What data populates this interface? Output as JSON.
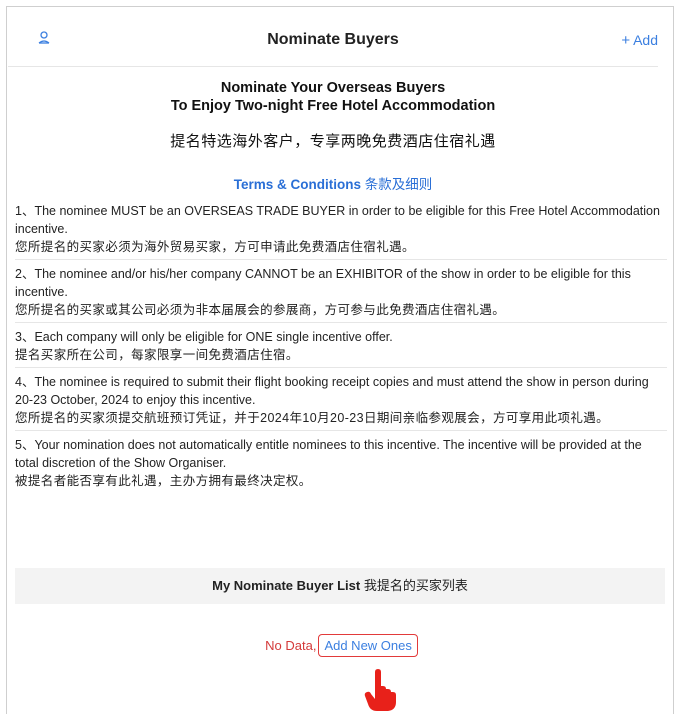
{
  "header": {
    "title": "Nominate Buyers",
    "add_plus": "+",
    "add_label": "Add"
  },
  "intro": {
    "line1": "Nominate Your Overseas Buyers",
    "line2": "To Enjoy Two-night Free Hotel Accommodation",
    "cn": "提名特选海外客户，专享两晚免费酒店住宿礼遇"
  },
  "terms_title": {
    "en": "Terms & Conditions",
    "cn": "条款及细则"
  },
  "terms": [
    {
      "en": "1、The nominee MUST be an OVERSEAS TRADE BUYER in order to be eligible for this Free Hotel Accommodation incentive.",
      "cn": "您所提名的买家必须为海外贸易买家，方可申请此免费酒店住宿礼遇。"
    },
    {
      "en": "2、The nominee and/or his/her company CANNOT be an EXHIBITOR of the show in order to be eligible for this incentive.",
      "cn": "您所提名的买家或其公司必须为非本届展会的参展商，方可参与此免费酒店住宿礼遇。"
    },
    {
      "en": "3、Each company will only be eligible for ONE single incentive offer.",
      "cn": "提名买家所在公司，每家限享一间免费酒店住宿。"
    },
    {
      "en": "4、The nominee is required to submit their flight booking receipt copies and must attend the show in person during 20-23 October, 2024 to enjoy this incentive.",
      "cn": "您所提名的买家须提交航班预订凭证，并于2024年10月20-23日期间亲临参观展会，方可享用此项礼遇。"
    },
    {
      "en": "5、Your nomination does not automatically entitle nominees to this incentive. The incentive will be provided at the total discretion of the Show Organiser.",
      "cn": "被提名者能否享有此礼遇，主办方拥有最终决定权。"
    }
  ],
  "list": {
    "title_en": "My Nominate Buyer List",
    "title_cn": "我提名的买家列表",
    "no_data": "No Data,",
    "add_new": "Add New Ones"
  },
  "colors": {
    "accent": "#3b7fe0",
    "error": "#d43a3a",
    "highlight_box": "#e23a3a"
  },
  "icons": {
    "header_left": "user-icon",
    "pointer": "pointing-hand-icon"
  }
}
